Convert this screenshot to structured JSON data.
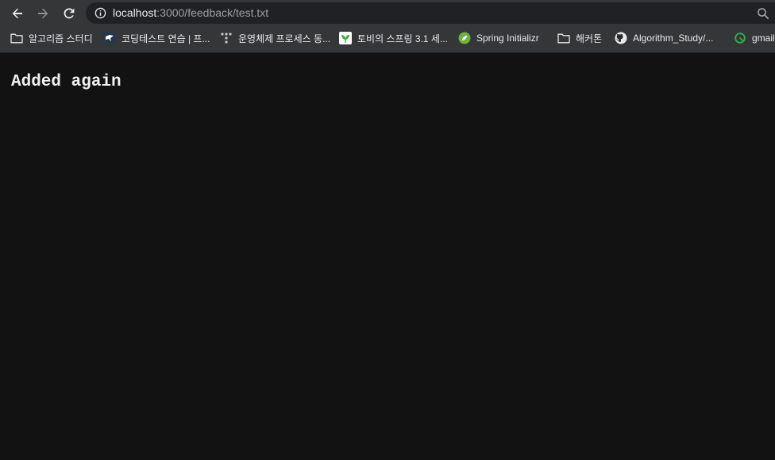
{
  "address_bar": {
    "host": "localhost",
    "rest": ":3000/feedback/test.txt"
  },
  "bookmarks": [
    {
      "label": "알고리즘 스터디",
      "icon": "folder-icon"
    },
    {
      "label": "코딩테스트 연습 | 프...",
      "icon": "programmers-icon"
    },
    {
      "label": "운영체제 프로세스 동...",
      "icon": "tistory-icon"
    },
    {
      "label": "토비의 스프링 3.1 세...",
      "icon": "leaf-icon"
    },
    {
      "label": "Spring Initializr",
      "icon": "spring-icon"
    },
    {
      "label": "해커톤",
      "icon": "folder-icon"
    },
    {
      "label": "Algorithm_Study/...",
      "icon": "github-icon"
    },
    {
      "label": "gmail",
      "icon": "green-circle-icon"
    }
  ],
  "page": {
    "text": "Added again"
  },
  "colors": {
    "chrome_bg": "#353638",
    "omnibox_bg": "#202124",
    "page_bg": "#121212",
    "text": "#e8eaed",
    "muted": "#9aa0a6"
  }
}
